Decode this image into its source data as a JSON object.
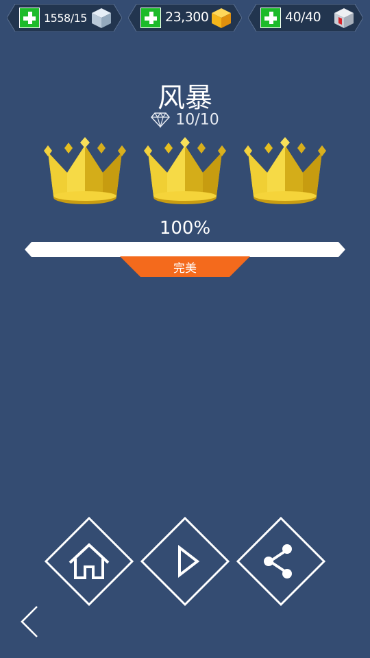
{
  "resources": {
    "ice": {
      "value": "1558/15",
      "icon": "ice-cube-icon"
    },
    "gold": {
      "value": "23,300",
      "icon": "gold-cube-icon"
    },
    "energy": {
      "value": "40/40",
      "icon": "energy-cube-icon"
    },
    "add_icon": "plus-icon"
  },
  "level": {
    "title": "风暴",
    "gems": "10/10",
    "gem_icon": "diamond-icon",
    "crowns_earned": 3,
    "progress_text": "100%",
    "progress_fraction": 1.0,
    "rating": "完美"
  },
  "nav": {
    "home_icon": "home-icon",
    "play_icon": "play-icon",
    "share_icon": "share-icon",
    "back_icon": "back-chevron-icon"
  },
  "colors": {
    "background": "#344c72",
    "accent_orange": "#f46a1c",
    "plus_green": "#1dbb2a",
    "crown_gold": "#e8c21e"
  }
}
